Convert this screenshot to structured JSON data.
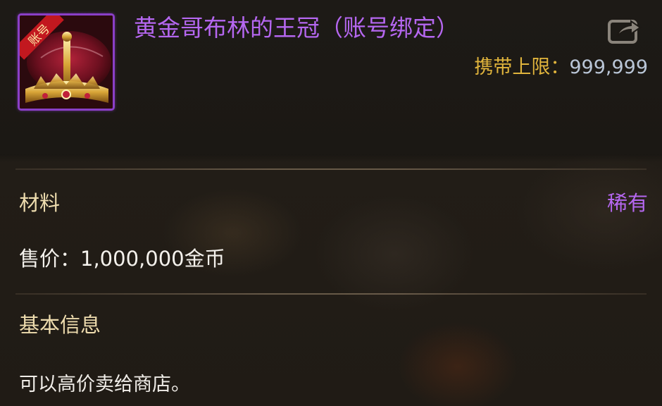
{
  "item": {
    "name": "黄金哥布林的王冠（账号绑定）",
    "icon": "golden-goblin-crown-icon",
    "badge": "账号",
    "rarity_color": "#b567f0",
    "frame_color": "#8a3fc7"
  },
  "carry_limit": {
    "label": "携带上限：",
    "value": "999,999"
  },
  "share_icon": "share-export-icon",
  "details": {
    "type": "材料",
    "rarity": "稀有",
    "price": "售价：1,000,000金币"
  },
  "basic_info": {
    "title": "基本信息",
    "description": "可以高价卖给商店。"
  }
}
